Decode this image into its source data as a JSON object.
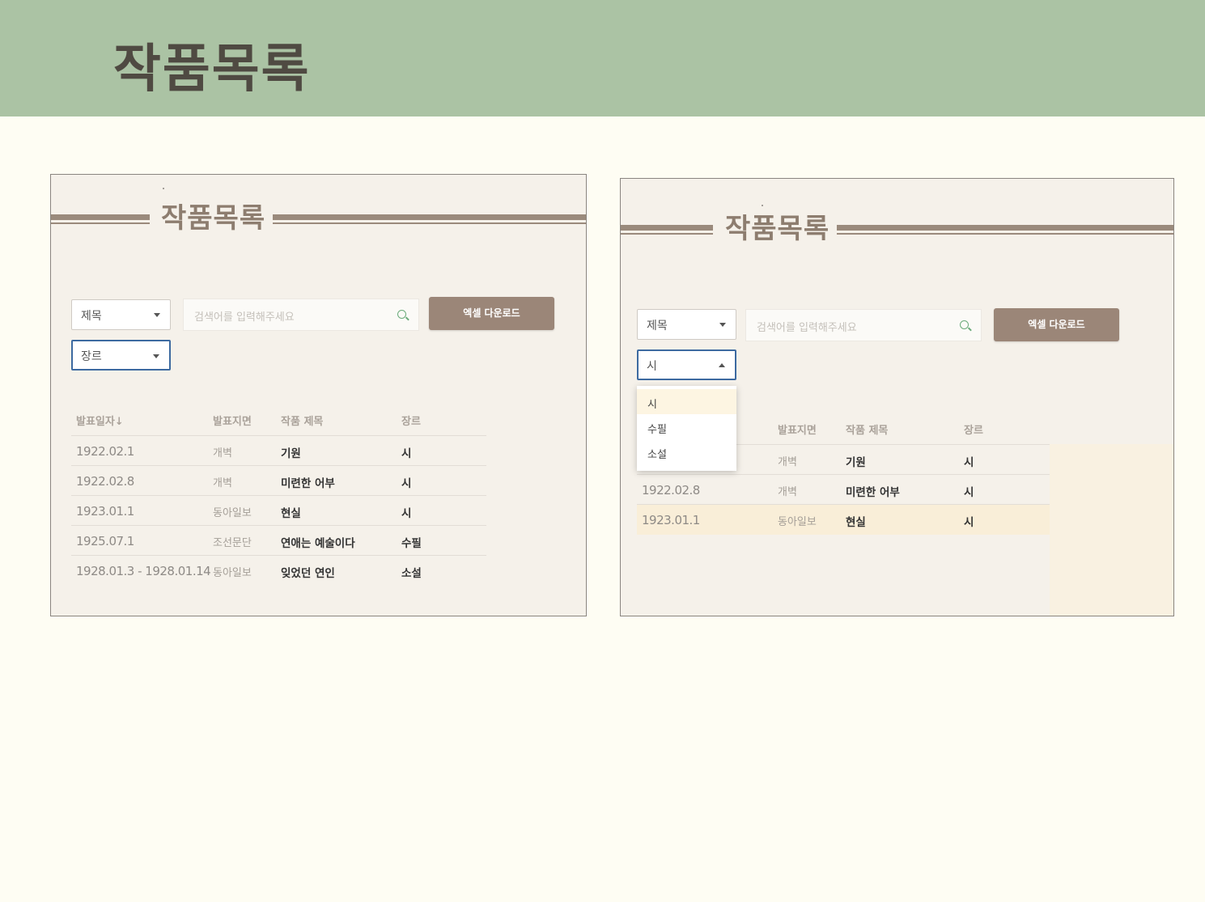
{
  "slide": {
    "title": "작품목록"
  },
  "panels": [
    {
      "title": "작품목록",
      "search_field_select": "제목",
      "genre_select": "장르",
      "search_placeholder": "검색어를 입력해주세요",
      "excel_button": "엑셀 다운로드",
      "columns": [
        "발표일자↓",
        "발표지면",
        "작품 제목",
        "장르"
      ],
      "rows": [
        {
          "date": "1922.02.1",
          "pub": "개벽",
          "title": "기원",
          "genre": "시"
        },
        {
          "date": "1922.02.8",
          "pub": "개벽",
          "title": "미련한 어부",
          "genre": "시"
        },
        {
          "date": "1923.01.1",
          "pub": "동아일보",
          "title": "현실",
          "genre": "시"
        },
        {
          "date": "1925.07.1",
          "pub": "조선문단",
          "title": "연애는 예술이다",
          "genre": "수필"
        },
        {
          "date": "1928.01.3 - 1928.01.14",
          "pub": "동아일보",
          "title": "잊었던 연인",
          "genre": "소설"
        }
      ]
    },
    {
      "title": "작품목록",
      "search_field_select": "제목",
      "genre_select": "시",
      "search_placeholder": "검색어를 입력해주세요",
      "excel_button": "엑셀 다운로드",
      "dropdown_options": [
        "시",
        "수필",
        "소설"
      ],
      "columns": [
        "발표지면",
        "작품 제목",
        "장르"
      ],
      "rows": [
        {
          "date": "",
          "pub": "개벽",
          "title": "기원",
          "genre": "시"
        },
        {
          "date": "1922.02.8",
          "pub": "개벽",
          "title": "미련한 어부",
          "genre": "시"
        },
        {
          "date": "1923.01.1",
          "pub": "동아일보",
          "title": "현실",
          "genre": "시"
        }
      ]
    }
  ]
}
